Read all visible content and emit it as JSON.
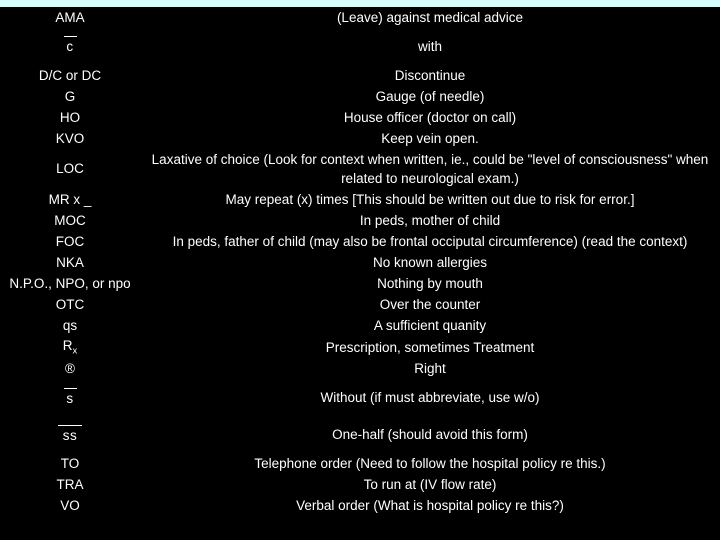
{
  "slide": {
    "accent_bar_color": "#d6fcfc",
    "background_color": "#000000",
    "text_color": "#ffffff"
  },
  "rows": [
    {
      "abbrev": "AMA",
      "meaning": "(Leave) against medical advice"
    },
    {
      "abbrev": "c",
      "abbrev_kind": "overbar-short",
      "meaning": "with"
    },
    {
      "abbrev": "D/C or DC",
      "meaning": "Discontinue"
    },
    {
      "abbrev": "G",
      "meaning": "Gauge (of needle)"
    },
    {
      "abbrev": "HO",
      "meaning": "House officer (doctor on call)"
    },
    {
      "abbrev": "KVO",
      "meaning": "Keep vein open."
    },
    {
      "abbrev": "LOC",
      "meaning": "Laxative of choice (Look for context when written, ie., could be \"level of consciousness\" when related to neurological exam.)"
    },
    {
      "abbrev": "MR x _",
      "meaning": "May repeat  (x) times [This should be written out due to risk for error.]"
    },
    {
      "abbrev": "MOC",
      "meaning": "In peds, mother of child"
    },
    {
      "abbrev": "FOC",
      "meaning": "In peds, father of child (may also be frontal occiputal circumference) (read the context)"
    },
    {
      "abbrev": "NKA",
      "meaning": "No known allergies"
    },
    {
      "abbrev": "N.P.O., NPO, or npo",
      "meaning": "Nothing by mouth"
    },
    {
      "abbrev": "OTC",
      "meaning": "Over the counter"
    },
    {
      "abbrev": "qs",
      "meaning": "A sufficient quanity"
    },
    {
      "abbrev": "Rx",
      "abbrev_kind": "rx-subscript",
      "meaning": "Prescription, sometimes Treatment"
    },
    {
      "abbrev": "®",
      "meaning": "Right"
    },
    {
      "abbrev": "s",
      "abbrev_kind": "overbar-short",
      "meaning": "Without (if must abbreviate, use w/o)"
    },
    {
      "abbrev": "ss",
      "abbrev_kind": "overbar-wide",
      "meaning": "One-half (should avoid this form)"
    },
    {
      "abbrev": "TO",
      "meaning": "Telephone order  (Need to follow the hospital policy re this.)"
    },
    {
      "abbrev": "TRA",
      "meaning": "To run at (IV flow rate)"
    },
    {
      "abbrev": "VO",
      "meaning": "Verbal order  (What is hospital policy re this?)"
    }
  ]
}
